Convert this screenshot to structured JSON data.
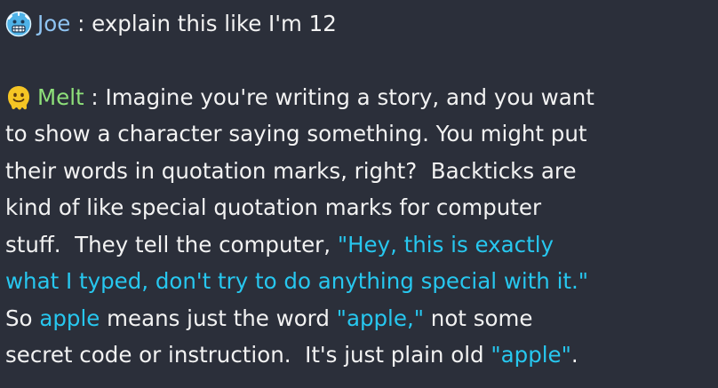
{
  "messages": [
    {
      "icon": "cold-face-emoji-icon",
      "user": "Joe",
      "separator": " : ",
      "text": "explain this like I'm 12"
    },
    {
      "icon": "melting-face-emoji-icon",
      "user": "Melt",
      "separator": " : ",
      "lines": [
        [
          {
            "t": "Imagine you're writing a story, and you want",
            "hl": false
          }
        ],
        [
          {
            "t": "to show a character saying something. You might put",
            "hl": false
          }
        ],
        [
          {
            "t": "their words in quotation marks, right?  Backticks are",
            "hl": false
          }
        ],
        [
          {
            "t": "kind of like special quotation marks for computer",
            "hl": false
          }
        ],
        [
          {
            "t": "stuff.  They tell the computer, ",
            "hl": false
          },
          {
            "t": "\"Hey, this is exactly",
            "hl": true
          }
        ],
        [
          {
            "t": "what I typed, don't try to do anything special with it.\"",
            "hl": true
          }
        ],
        [
          {
            "t": "So ",
            "hl": false
          },
          {
            "t": "apple",
            "hl": true
          },
          {
            "t": " means just the word ",
            "hl": false
          },
          {
            "t": "\"apple,\"",
            "hl": true
          },
          {
            "t": " not some",
            "hl": false
          }
        ],
        [
          {
            "t": "secret code or instruction.  It's just plain old ",
            "hl": false
          },
          {
            "t": "\"apple\"",
            "hl": true
          },
          {
            "t": ".",
            "hl": false
          }
        ]
      ]
    }
  ],
  "colors": {
    "background": "#2b2f3a",
    "text": "#f2f2f2",
    "joe_name": "#8fc4f2",
    "melt_name": "#8ee07a",
    "highlight": "#27c7ef"
  }
}
